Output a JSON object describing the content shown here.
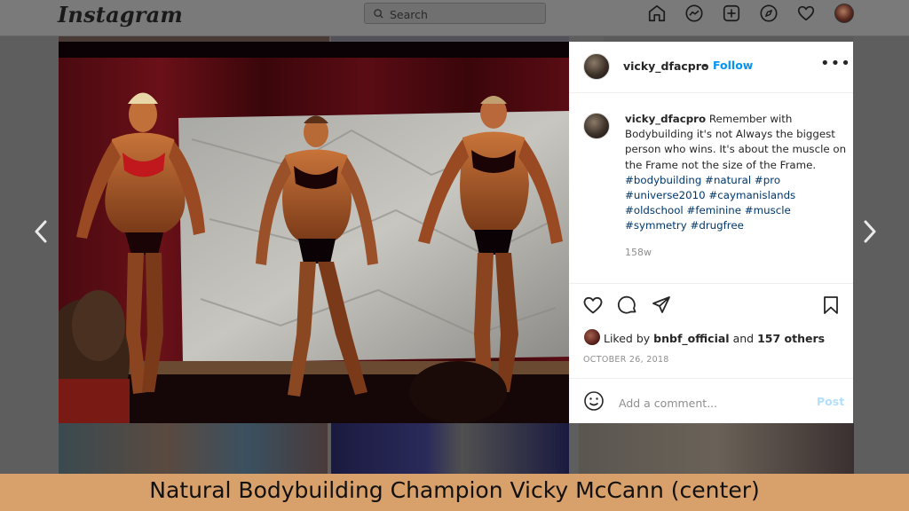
{
  "app": {
    "logo_text": "Instagram"
  },
  "search": {
    "placeholder": "Search"
  },
  "nav_icons": [
    "home-icon",
    "messenger-icon",
    "new-post-icon",
    "explore-icon",
    "activity-heart-icon",
    "profile-avatar"
  ],
  "post": {
    "username": "vicky_dfacpro",
    "follow_label": "Follow",
    "dot": "•",
    "more_label": "•••",
    "caption_text": "Remember with Bodybuilding it's not Always the biggest person who wins. It's about the muscle on the Frame not the size of the Frame.",
    "hashtags": "#bodybuilding #natural #pro #universe2010 #caymanislands #oldschool #feminine #muscle #symmetry #drugfree",
    "age": "158w",
    "liked_by_prefix": "Liked by",
    "liked_by_user": "bnbf_official",
    "liked_by_and": "and",
    "liked_by_others": "157 others",
    "date": "OCTOBER 26, 2018",
    "comment_placeholder": "Add a comment...",
    "post_label": "Post"
  },
  "overlay_caption": "Natural Bodybuilding Champion Vicky McCann (center)",
  "colors": {
    "link_blue": "#0095f6",
    "hashtag_blue": "#00376b",
    "caption_bar": "#d8a06a"
  }
}
